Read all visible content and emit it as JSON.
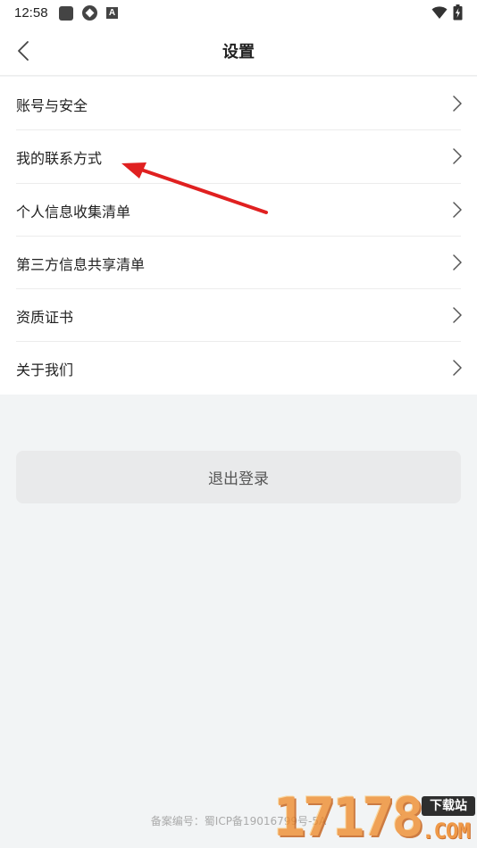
{
  "status_bar": {
    "time": "12:58",
    "left_icons": [
      "app-square-icon",
      "app-round-icon",
      "app-a-icon"
    ],
    "a_icon_glyph": "A",
    "right_icons": [
      "wifi-icon",
      "battery-charging-icon"
    ]
  },
  "nav": {
    "title": "设置",
    "back_icon": "chevron-left-icon"
  },
  "menu": {
    "items": [
      {
        "label": "账号与安全"
      },
      {
        "label": "我的联系方式"
      },
      {
        "label": "个人信息收集清单"
      },
      {
        "label": "第三方信息共享清单"
      },
      {
        "label": "资质证书"
      },
      {
        "label": "关于我们"
      }
    ]
  },
  "logout_label": "退出登录",
  "footer": {
    "icp": "备案编号：蜀ICP备19016799号-5A"
  },
  "watermark": {
    "digits": "17178",
    "badge": "下载站",
    "domain": ".COM"
  },
  "colors": {
    "background": "#f2f4f5",
    "surface": "#ffffff",
    "annotation_arrow": "#e02020",
    "watermark": "#ef8a2a"
  }
}
